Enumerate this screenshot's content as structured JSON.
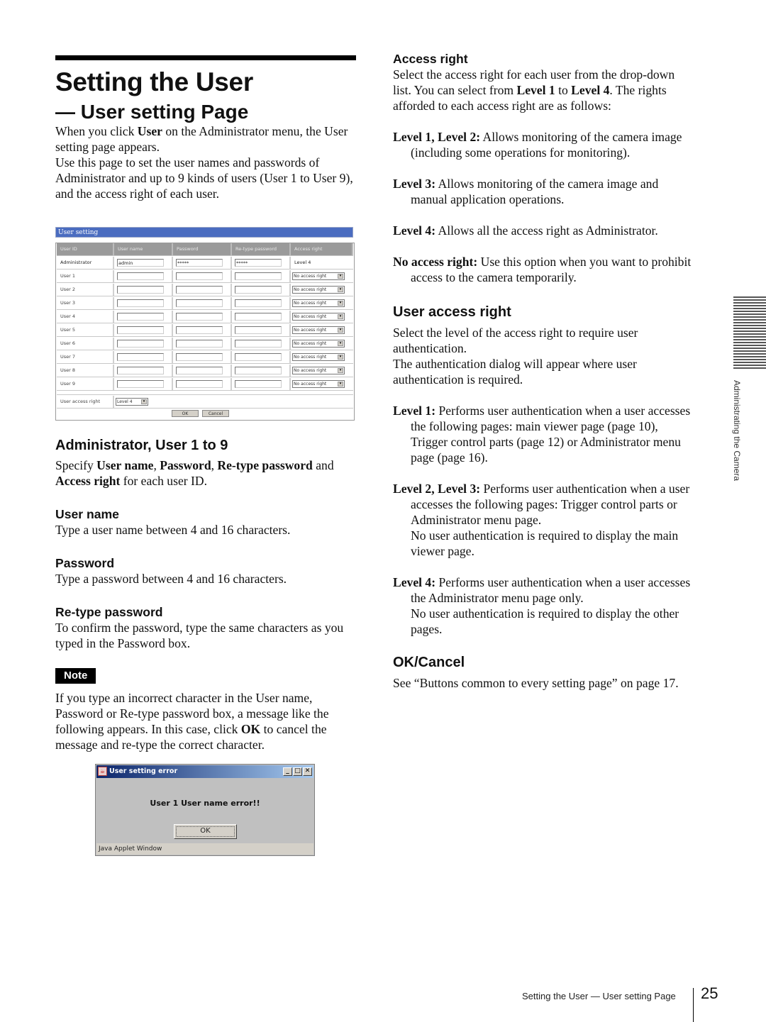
{
  "page": {
    "title": "Setting the User",
    "subtitle": "— User setting Page",
    "intro_p1_a": "When you click ",
    "intro_p1_b": "User",
    "intro_p1_c": " on the Administrator menu, the User setting page appears.",
    "intro_p2": "Use this page to set the user names and passwords of Administrator and up to 9 kinds of users (User 1 to User 9), and the access right of each user."
  },
  "form": {
    "window_title": "User setting",
    "columns": [
      "User ID",
      "User name",
      "Password",
      "Re-type password",
      "Access right"
    ],
    "admin_row": {
      "id": "Administrator",
      "user_name": "admin",
      "password": "*****",
      "retype_password": "*****",
      "access_right": "Level 4"
    },
    "user_rows": [
      {
        "id": "User 1",
        "access_right": "No access right"
      },
      {
        "id": "User 2",
        "access_right": "No access right"
      },
      {
        "id": "User 3",
        "access_right": "No access right"
      },
      {
        "id": "User 4",
        "access_right": "No access right"
      },
      {
        "id": "User 5",
        "access_right": "No access right"
      },
      {
        "id": "User 6",
        "access_right": "No access right"
      },
      {
        "id": "User 7",
        "access_right": "No access right"
      },
      {
        "id": "User 8",
        "access_right": "No access right"
      },
      {
        "id": "User 9",
        "access_right": "No access right"
      }
    ],
    "user_access_right_label": "User access right",
    "user_access_right_value": "Level 4",
    "ok_label": "OK",
    "cancel_label": "Cancel",
    "select_arrow": "▾"
  },
  "admin_section": {
    "heading": "Administrator, User 1 to 9",
    "p_a": "Specify ",
    "p_b1": "User name",
    "p_sep1": ", ",
    "p_b2": "Password",
    "p_sep2": ", ",
    "p_b3": "Re-type password",
    "p_sep3": " and ",
    "p_b4": "Access right",
    "p_end": " for each user ID.",
    "user_name_heading": "User name",
    "user_name_text": "Type a user name between 4 and 16 characters.",
    "password_heading": "Password",
    "password_text": "Type a password between 4 and 16 characters.",
    "retype_heading": "Re-type password",
    "retype_text": "To confirm the password, type the same characters as you typed in the Password box."
  },
  "note": {
    "badge": "Note",
    "text_a": "If you type an incorrect character in the User name, Password or Re-type password box, a message like the following appears.  In this case, click ",
    "text_b": "OK",
    "text_c": " to cancel the message and re-type the correct character."
  },
  "dialog": {
    "title": "User setting error",
    "message": "User 1 User name error!!",
    "ok_label": "OK",
    "status": "Java Applet Window",
    "minimize": "_",
    "maximize": "□",
    "close": "✕"
  },
  "access_right": {
    "heading": "Access right",
    "intro_a": "Select the access right for each user from the drop-down list.  You can select from ",
    "intro_b1": "Level 1",
    "intro_mid": " to ",
    "intro_b2": "Level 4",
    "intro_end": ".  The rights afforded to each access right are as follows:",
    "items": [
      {
        "term": "Level 1, Level 2:",
        "desc": " Allows monitoring of the camera image (including some operations for monitoring)."
      },
      {
        "term": "Level 3:",
        "desc": " Allows monitoring of the camera image and manual application operations."
      },
      {
        "term": "Level 4:",
        "desc": " Allows all the access right as Administrator."
      },
      {
        "term": "No access right:",
        "desc": " Use this option when you want to prohibit access to the camera temporarily."
      }
    ]
  },
  "user_access_right": {
    "heading": "User access right",
    "p1": "Select the level of the access right to require user authentication.",
    "p2": "The authentication dialog will appear where user authentication is required.",
    "items": [
      {
        "term": "Level 1:",
        "desc": " Performs user authentication when a user accesses the following pages:  main viewer page (page 10), Trigger control parts (page 12) or Administrator menu page (page 16)."
      },
      {
        "term": "Level 2, Level 3:",
        "desc": " Performs user authentication when a user accesses the following pages:  Trigger control parts or Administrator menu page.",
        "extra": "No user authentication is required to display the main viewer page."
      },
      {
        "term": "Level 4:",
        "desc": " Performs user authentication when a user accesses the Administrator menu page only.",
        "extra": "No user authentication is required to display the other pages."
      }
    ]
  },
  "ok_cancel": {
    "heading": "OK/Cancel",
    "text": "See “Buttons common to every setting page” on page 17."
  },
  "side_tab": {
    "label": "Administrating the Camera"
  },
  "footer": {
    "running_title": "Setting the User — User setting Page",
    "page_number": "25"
  }
}
